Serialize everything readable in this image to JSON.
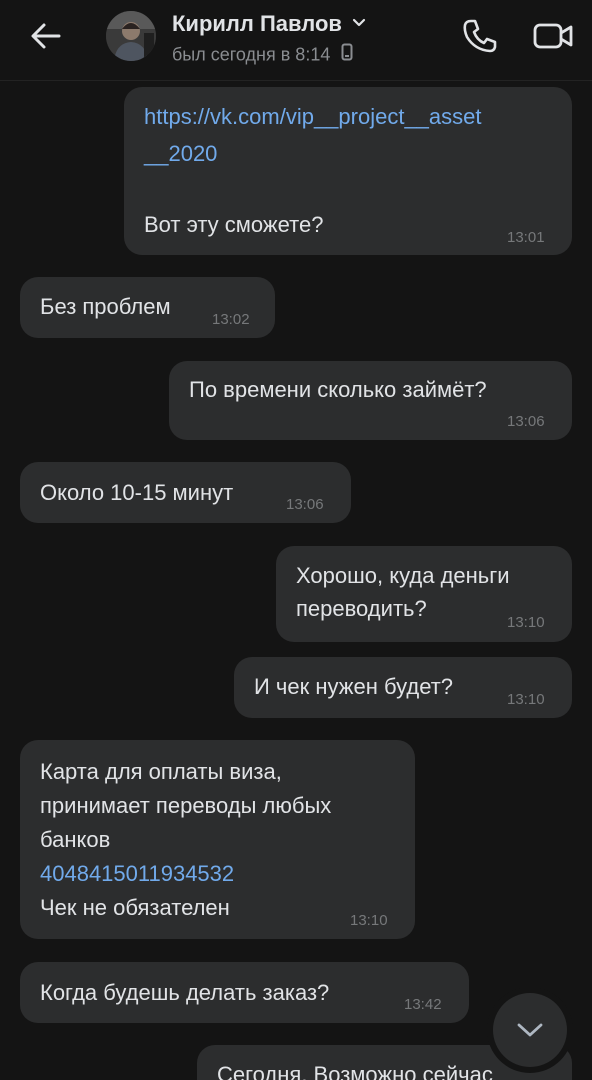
{
  "header": {
    "contact_name": "Кирилл Павлов",
    "status": "был сегодня в 8:14"
  },
  "messages": [
    {
      "link": "https://vk.com/vip__project__asset",
      "link2": "__2020",
      "text": "Вот эту сможете?",
      "time": "13:01"
    },
    {
      "text": "Без проблем",
      "time": "13:02"
    },
    {
      "text": "По времени сколько займёт?",
      "time": "13:06"
    },
    {
      "text": "Около 10-15 минут",
      "time": "13:06"
    },
    {
      "line1": "Хорошо, куда деньги",
      "line2": "переводить?",
      "time": "13:10"
    },
    {
      "text": "И чек нужен будет?",
      "time": "13:10"
    },
    {
      "line1": "Карта для оплаты виза,",
      "line2": "принимает переводы любых",
      "line3": "банков",
      "card": "4048415011934532",
      "line5": "Чек не обязателен",
      "time": "13:10"
    },
    {
      "text": "Когда будешь делать заказ?",
      "time": "13:42"
    },
    {
      "text": "Сегодня. Возможно сейчас"
    }
  ],
  "colors": {
    "background": "#141414",
    "bubble": "#2c2d2e",
    "link": "#71aaeb",
    "text": "#e1e3e6",
    "secondary": "#76787a"
  },
  "icons": [
    "back-arrow-icon",
    "chevron-down-icon",
    "phone-status-icon",
    "phone-call-icon",
    "video-camera-icon",
    "chevron-down-icon"
  ]
}
